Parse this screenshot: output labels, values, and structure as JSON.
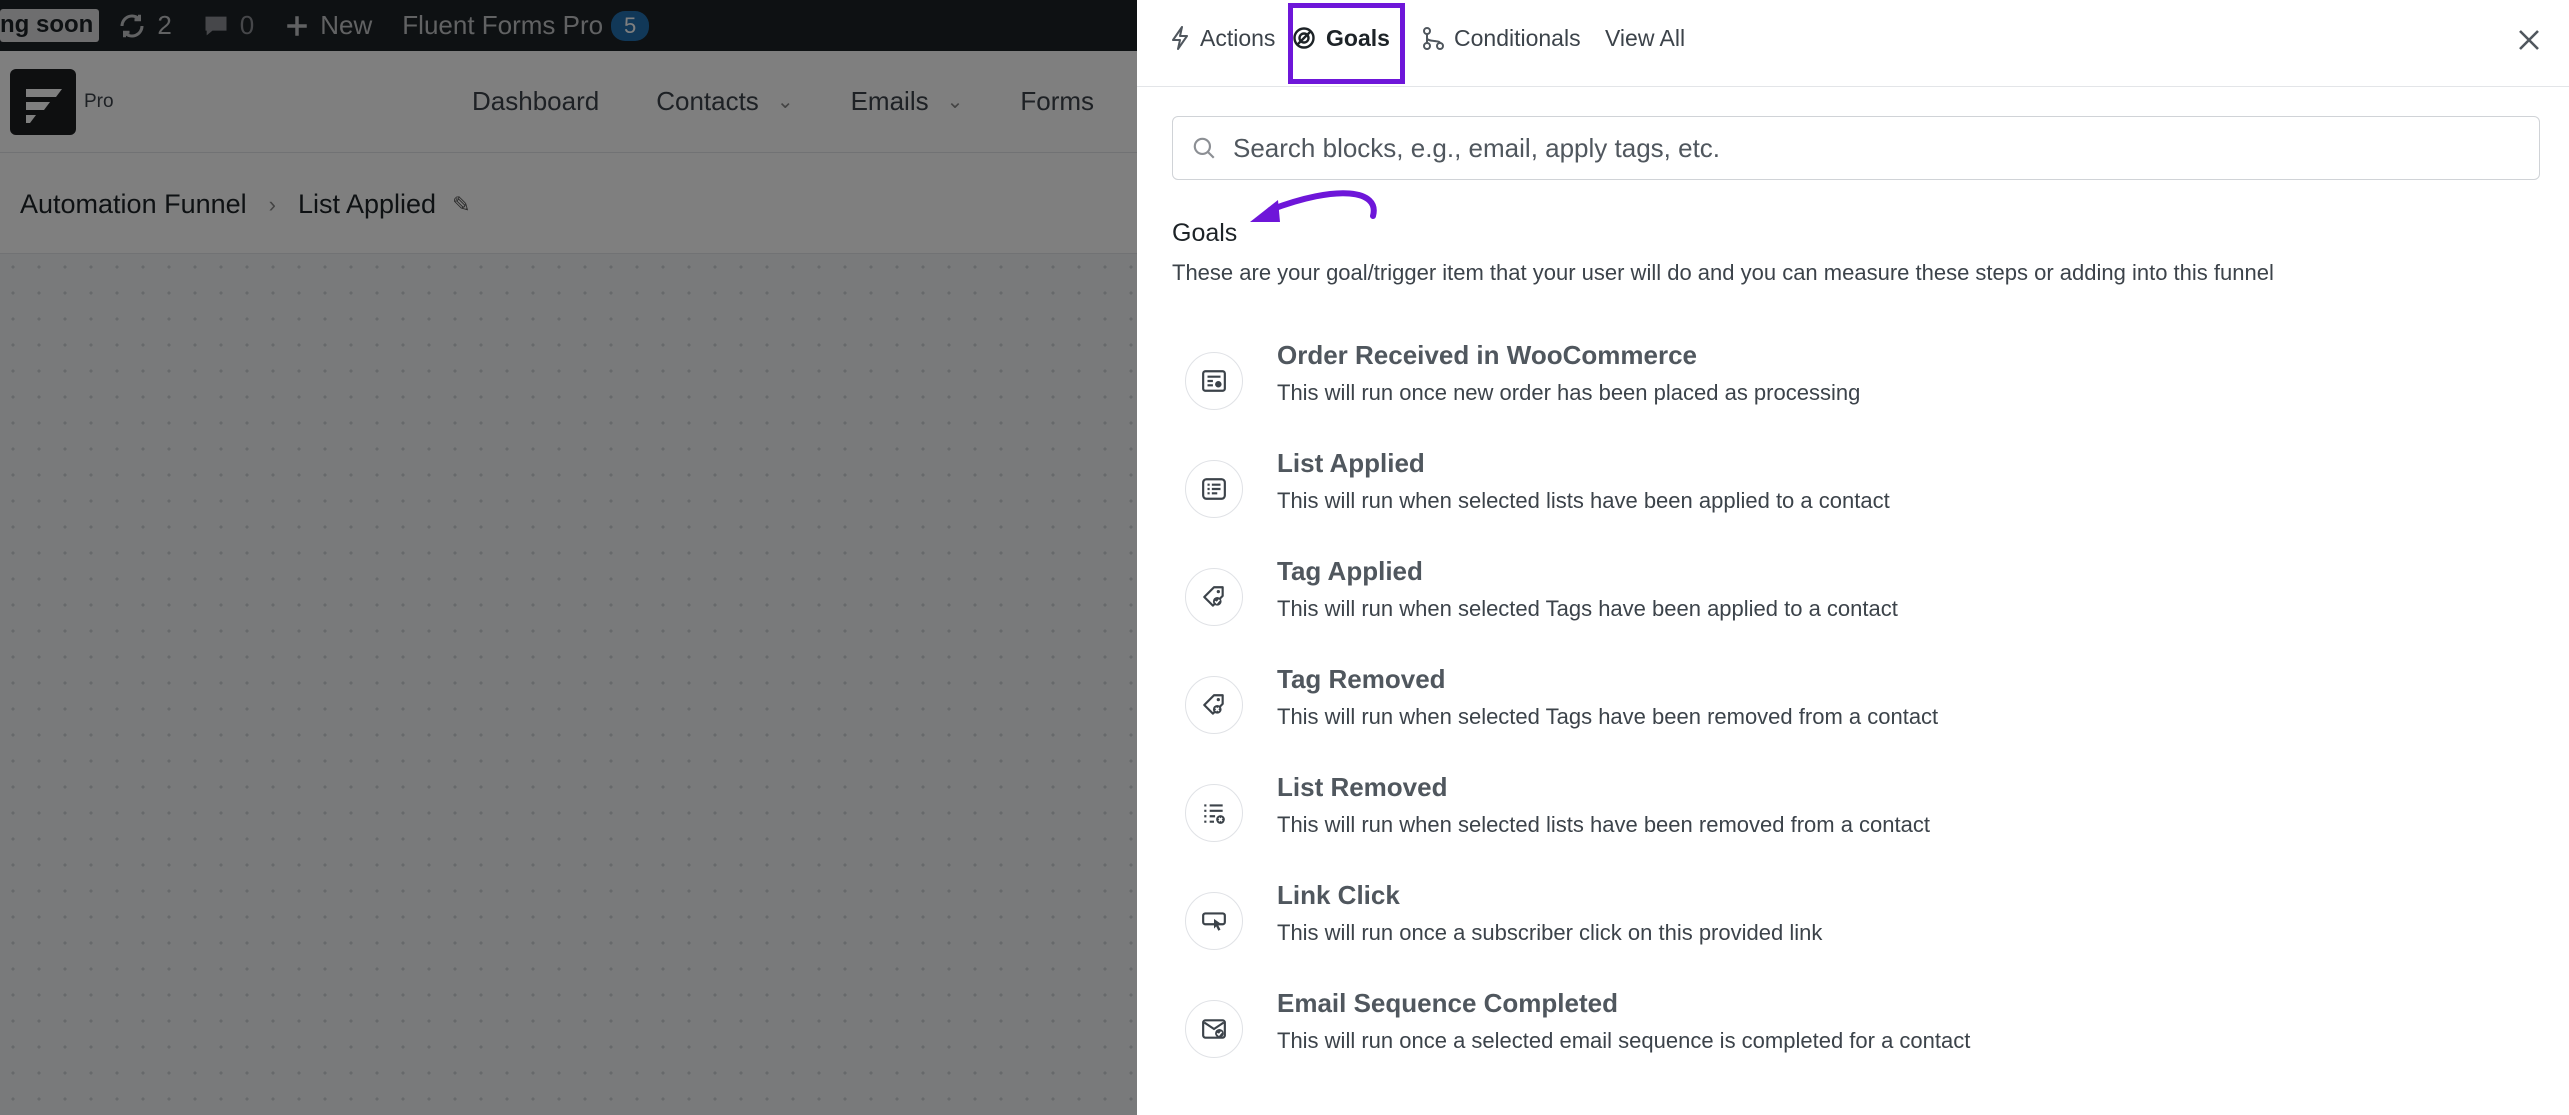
{
  "adminbar": {
    "coming_soon": "ng soon",
    "updates_count": "2",
    "comments_count": "0",
    "new_label": "New",
    "plugin_label": "Fluent Forms Pro",
    "plugin_badge": "5"
  },
  "header": {
    "logo_badge": "Pro",
    "nav": [
      {
        "label": "Dashboard"
      },
      {
        "label": "Contacts"
      },
      {
        "label": "Emails"
      },
      {
        "label": "Forms"
      }
    ]
  },
  "breadcrumb": {
    "root": "Automation Funnel",
    "current": "List Applied"
  },
  "drawer": {
    "tabs": {
      "actions": "Actions",
      "goals": "Goals",
      "conditionals": "Conditionals",
      "view_all": "View All"
    },
    "search_placeholder": "Search blocks, e.g., email, apply tags, etc.",
    "section_title": "Goals",
    "section_description": "These are your goal/trigger item that your user will do and you can measure these steps or adding into this funnel",
    "items": [
      {
        "title": "Order Received in WooCommerce",
        "desc": "This will run once new order has been placed as processing",
        "icon": "order-icon"
      },
      {
        "title": "List Applied",
        "desc": "This will run when selected lists have been applied to a contact",
        "icon": "list-applied-icon"
      },
      {
        "title": "Tag Applied",
        "desc": "This will run when selected Tags have been applied to a contact",
        "icon": "tag-applied-icon"
      },
      {
        "title": "Tag Removed",
        "desc": "This will run when selected Tags have been removed from a contact",
        "icon": "tag-removed-icon"
      },
      {
        "title": "List Removed",
        "desc": "This will run when selected lists have been removed from a contact",
        "icon": "list-removed-icon"
      },
      {
        "title": "Link Click",
        "desc": "This will run once a subscriber click on this provided link",
        "icon": "link-click-icon"
      },
      {
        "title": "Email Sequence Completed",
        "desc": "This will run once a selected email sequence is completed for a contact",
        "icon": "email-sequence-icon"
      }
    ]
  },
  "colors": {
    "highlight": "#6e16d9",
    "adminbar": "#1d2327",
    "badge": "#2271b1"
  }
}
